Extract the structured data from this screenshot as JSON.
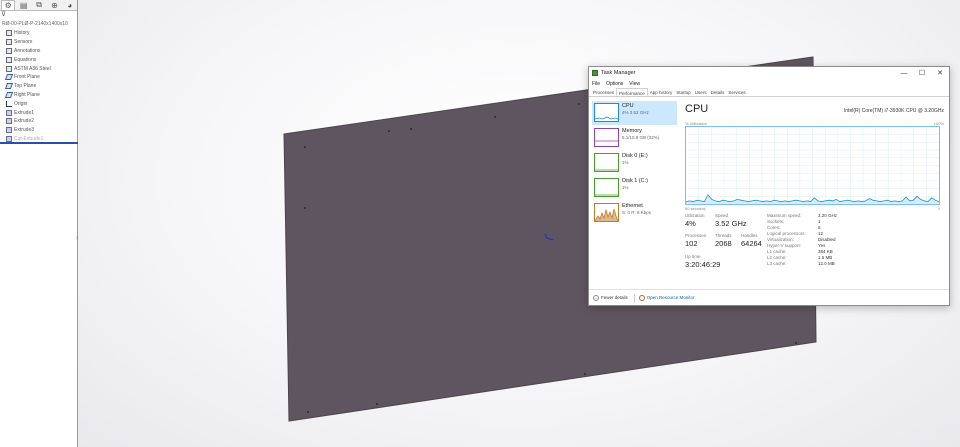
{
  "feature_manager": {
    "tab_icons": [
      "feature-tree-icon",
      "property-manager-icon",
      "configuration-manager-icon",
      "dimxpert-icon",
      "display-manager-icon"
    ],
    "filter_icon": "filter-icon",
    "root_label": "RØ-00-PLØ-P-2140x1400x10",
    "items": [
      {
        "label": "History",
        "icon": "history-icon",
        "kind": "folder"
      },
      {
        "label": "Sensors",
        "icon": "sensor-icon",
        "kind": "folder"
      },
      {
        "label": "Annotations",
        "icon": "annotations-icon",
        "kind": "folder"
      },
      {
        "label": "Equations",
        "icon": "equations-icon",
        "kind": "folder"
      },
      {
        "label": "ASTM A36 Steel",
        "icon": "material-icon",
        "kind": "folder"
      },
      {
        "label": "Front Plane",
        "icon": "plane-icon",
        "kind": "plane"
      },
      {
        "label": "Top Plane",
        "icon": "plane-icon",
        "kind": "plane"
      },
      {
        "label": "Right Plane",
        "icon": "plane-icon",
        "kind": "plane"
      },
      {
        "label": "Origin",
        "icon": "origin-icon",
        "kind": "origin"
      },
      {
        "label": "Extrude1",
        "icon": "extrude-icon",
        "kind": "feat"
      },
      {
        "label": "Extrude2",
        "icon": "extrude-icon",
        "kind": "feat"
      },
      {
        "label": "Extrude3",
        "icon": "extrude-icon",
        "kind": "feat"
      },
      {
        "label": "Cut-Extrude1",
        "icon": "cut-extrude-icon",
        "kind": "muted"
      }
    ]
  },
  "viewport": {
    "plate_color": "#5f5560",
    "background": "#f4f4f6"
  },
  "task_manager": {
    "title": "Task Manager",
    "window_buttons": {
      "minimize": "—",
      "maximize": "☐",
      "close": "✕"
    },
    "menu": [
      "File",
      "Options",
      "View"
    ],
    "tabs": [
      "Processes",
      "Performance",
      "App history",
      "Startup",
      "Users",
      "Details",
      "Services"
    ],
    "active_tab": "Performance",
    "resources": [
      {
        "title": "CPU",
        "subtitle": "4% 3.52 GHz",
        "color": "#1b8ed6"
      },
      {
        "title": "Memory",
        "subtitle": "5.1/15.8 GB (32%)",
        "color": "#8e44ad"
      },
      {
        "title": "Disk 0 (E:)",
        "subtitle": "1%",
        "color": "#4a9b2e"
      },
      {
        "title": "Disk 1 (C:)",
        "subtitle": "1%",
        "color": "#4a9b2e"
      },
      {
        "title": "Ethernet",
        "subtitle": "S: 0 R: 8 Kbps",
        "color": "#c27a2c"
      }
    ],
    "cpu": {
      "heading": "CPU",
      "model": "Intel(R) Core(TM) i7-3930K CPU @ 3.20GHz",
      "util_label": "% Utilization",
      "util_max": "100%",
      "graph_time": "60 seconds",
      "graph_end": "0",
      "graph_values": [
        3,
        4,
        3,
        5,
        4,
        3,
        12,
        6,
        4,
        3,
        5,
        4,
        3,
        4,
        6,
        5,
        4,
        3,
        4,
        5,
        4,
        3,
        4,
        3,
        5,
        4,
        3,
        4,
        3,
        4,
        5,
        4,
        3,
        4,
        3,
        8,
        4,
        3,
        4,
        5,
        4,
        6,
        3,
        4,
        5,
        4,
        3,
        4,
        3,
        4,
        7,
        5,
        4,
        3,
        4,
        5,
        3,
        4,
        3,
        4,
        9,
        4,
        5,
        10,
        6,
        4,
        3,
        8,
        5,
        3
      ],
      "stats": {
        "utilization": {
          "label": "Utilization",
          "value": "4%"
        },
        "speed": {
          "label": "Speed",
          "value": "3.52 GHz"
        },
        "processes": {
          "label": "Processes",
          "value": "102"
        },
        "threads": {
          "label": "Threads",
          "value": "2068"
        },
        "handles": {
          "label": "Handles",
          "value": "64264"
        },
        "uptime": {
          "label": "Up time",
          "value": "3:20:46:29"
        }
      },
      "specs": [
        {
          "k": "Maximum speed:",
          "v": "3.20 GHz"
        },
        {
          "k": "Sockets:",
          "v": "1"
        },
        {
          "k": "Cores:",
          "v": "6"
        },
        {
          "k": "Logical processors:",
          "v": "12"
        },
        {
          "k": "Virtualization:",
          "v": "Disabled"
        },
        {
          "k": "Hyper-V support:",
          "v": "Yes"
        },
        {
          "k": "L1 cache:",
          "v": "384 KB"
        },
        {
          "k": "L2 cache:",
          "v": "1.5 MB"
        },
        {
          "k": "L3 cache:",
          "v": "12.0 MB"
        }
      ]
    },
    "footer": {
      "fewer_details": "Fewer details",
      "open_resource_monitor": "Open Resource Monitor"
    }
  }
}
